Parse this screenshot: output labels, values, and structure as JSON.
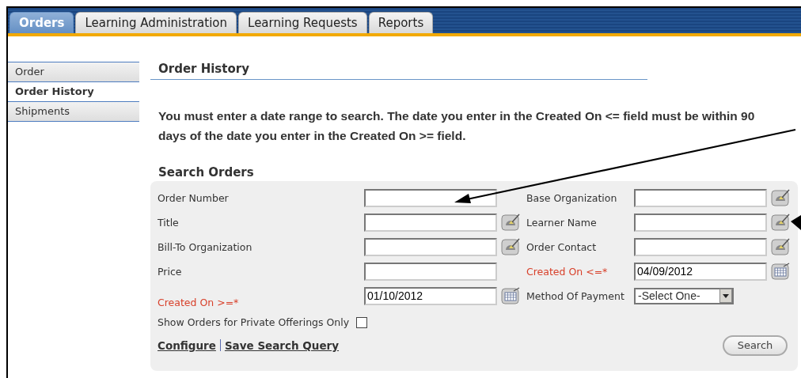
{
  "tabs": [
    {
      "label": "Orders",
      "selected": true
    },
    {
      "label": "Learning Administration",
      "selected": false
    },
    {
      "label": "Learning Requests",
      "selected": false
    },
    {
      "label": "Reports",
      "selected": false
    }
  ],
  "sidebar": {
    "items": [
      {
        "label": "Order",
        "selected": false
      },
      {
        "label": "Order History",
        "selected": true
      },
      {
        "label": "Shipments",
        "selected": false
      }
    ]
  },
  "page_title": "Order History",
  "instructions": "You must enter a date range to search. The date you enter in the Created On <= field must be within 90 days of the date you enter in the Created On >= field.",
  "search": {
    "title": "Search Orders",
    "rows": [
      {
        "left": {
          "label": "Order Number",
          "kind": "text",
          "required": false
        },
        "right": {
          "label": "Base Organization",
          "kind": "lookup",
          "required": false
        }
      },
      {
        "left": {
          "label": "Title",
          "kind": "lookup",
          "required": false
        },
        "right": {
          "label": "Learner Name",
          "kind": "lookup",
          "required": false
        }
      },
      {
        "left": {
          "label": "Bill-To Organization",
          "kind": "lookup",
          "required": false
        },
        "right": {
          "label": "Order Contact",
          "kind": "lookup",
          "required": false
        }
      },
      {
        "left": {
          "label": "Price",
          "kind": "text",
          "required": false
        },
        "right": {
          "label": "Created On <=*",
          "kind": "date",
          "required": true,
          "value": "04/09/2012"
        }
      },
      {
        "left": {
          "label": "Created On >=*",
          "kind": "date",
          "required": true,
          "value": "01/10/2012"
        },
        "right": {
          "label": "Method Of Payment",
          "kind": "select",
          "required": false,
          "value": "-Select One-"
        }
      }
    ],
    "checkbox": {
      "label": "Show Orders for Private Offerings Only",
      "checked": false
    },
    "links": [
      "Configure",
      "Save Search Query"
    ],
    "button": "Search"
  }
}
